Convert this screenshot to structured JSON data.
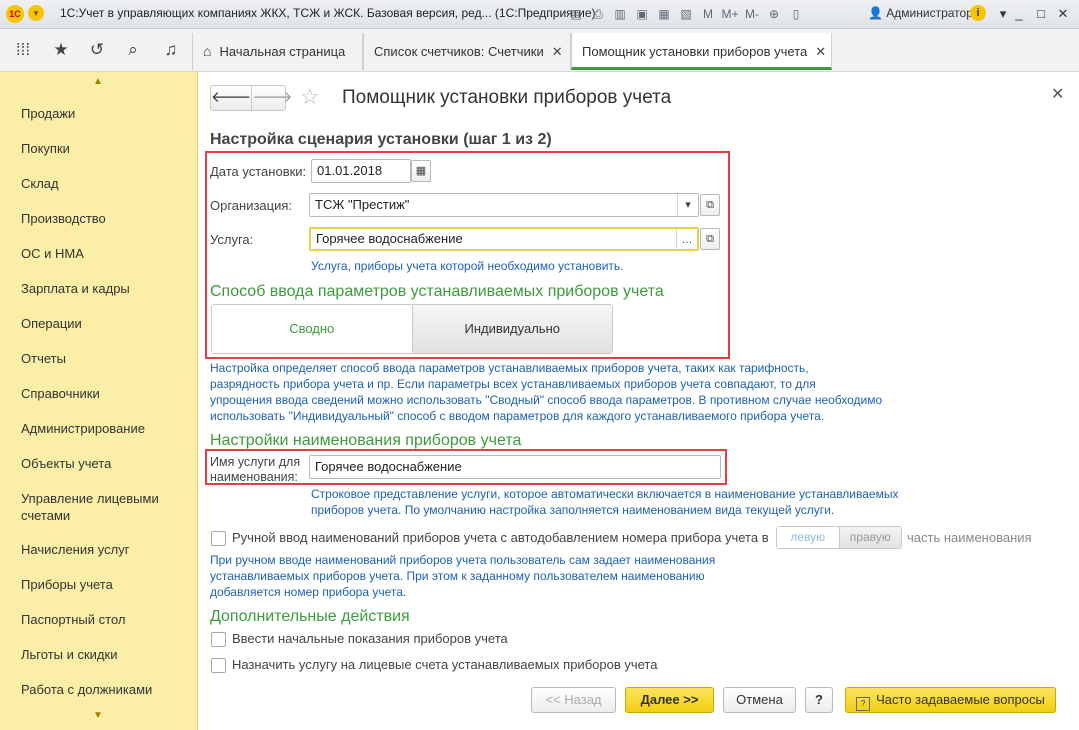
{
  "window": {
    "logo_text": "1С",
    "title": "1С:Учет в управляющих компаниях ЖКХ, ТСЖ и ЖСК. Базовая версия, ред... (1С:Предприятие)",
    "memory_labels": [
      "M",
      "M+",
      "M-"
    ],
    "user": "Администратор",
    "controls": [
      "_",
      "□",
      "✕"
    ]
  },
  "tabs": [
    {
      "label": "Начальная страница"
    },
    {
      "label": "Список счетчиков: Счетчики"
    },
    {
      "label": "Помощник установки приборов учета"
    }
  ],
  "sidebar": {
    "items": [
      "Продажи",
      "Покупки",
      "Склад",
      "Производство",
      "ОС и НМА",
      "Зарплата и кадры",
      "Операции",
      "Отчеты",
      "Справочники",
      "Администрирование",
      "Объекты учета",
      "Управление лицевыми счетами",
      "Начисления услуг",
      "Приборы учета",
      "Паспортный стол",
      "Льготы и скидки",
      "Работа с должниками"
    ]
  },
  "form": {
    "title": "Помощник установки приборов учета",
    "step_heading": "Настройка сценария установки (шаг 1 из 2)",
    "install_date": {
      "label": "Дата установки:",
      "value": "01.01.2018"
    },
    "organization": {
      "label": "Организация:",
      "value": "ТСЖ \"Престиж\""
    },
    "service": {
      "label": "Услуга:",
      "value": "Горячее водоснабжение",
      "hint": "Услуга, приборы учета которой необходимо установить."
    },
    "input_method": {
      "heading": "Способ ввода параметров устанавливаемых приборов учета",
      "options": [
        "Сводно",
        "Индивидуально"
      ],
      "selected": "Сводно",
      "hint_lines": [
        "Настройка определяет способ ввода параметров устанавливаемых приборов учета, таких как тарифность,",
        "разрядность прибора учета и пр. Если параметры всех устанавливаемых приборов учета совпадают, то для",
        "упрощения ввода сведений можно использовать \"Сводный\" способ ввода параметров. В противном случае необходимо",
        "использовать \"Индивидуальный\" способ с вводом параметров для каждого устанавливаемого прибора учета."
      ]
    },
    "naming": {
      "heading": "Настройки наименования приборов учета",
      "label_line1": "Имя услуги для",
      "label_line2": "наименования:",
      "value": "Горячее водоснабжение",
      "hint_lines": [
        "Строковое представление услуги, которое автоматически включается в наименование устанавливаемых",
        "приборов учета. По умолчанию настройка заполняется наименованием вида текущей услуги."
      ]
    },
    "manual_naming": {
      "label": "Ручной ввод наименований приборов учета с автодобавлением номера прибора учета в",
      "options": [
        "левую",
        "правую"
      ],
      "suffix": "часть наименования",
      "hint_lines": [
        "При ручном вводе наименований приборов учета пользователь сам задает наименования",
        "устанавливаемых приборов учета. При этом к заданному пользователем наименованию",
        "добавляется номер прибора учета."
      ]
    },
    "extra": {
      "heading": "Дополнительные действия",
      "opt1": "Ввести начальные показания приборов учета",
      "opt2": "Назначить услугу на лицевые счета устанавливаемых приборов учета"
    },
    "buttons": {
      "back": "<< Назад",
      "next": "Далее >>",
      "cancel": "Отмена",
      "help": "?",
      "faq": "Часто задаваемые вопросы"
    }
  }
}
